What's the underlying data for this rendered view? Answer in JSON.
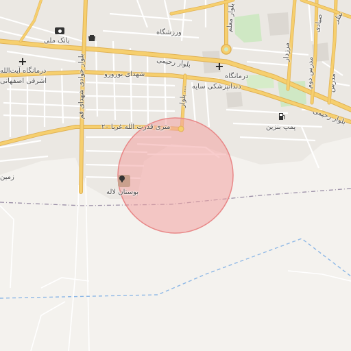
{
  "map": {
    "accent_road_color": "#f6cf6e",
    "circle_color": "#f3a3a3",
    "labels": {
      "bank_melli": "بانک ملی",
      "varzeshgah": "ورزشگاه",
      "darmangah_ayatollah_1": "درمانگاه آیت‌الله",
      "darmangah_ayatollah_2": "اشرفی اصفهانی",
      "shohadaye_borujerd": "شهدای بورورو",
      "blvd_rahimi_1": "بلوار رحیمی",
      "blvd_rahimi_2": "بلوار رحیمی",
      "blvd_moallem": "بلوار معلم",
      "darmangah": "درمانگاه",
      "dandanpezeshki": "دندانپزشکی سایه",
      "blvd_javadi": "بلوار جوادی شهدای قم",
      "qodratollah": "۲۰ متری قدرت الله غربا",
      "pomp_benzin": "پمپ بنزین",
      "bostan_laleh": "بوستان لاله",
      "zamin": "زمین",
      "marzdar": "مرزدار",
      "modares_doom": "مدرس دوم",
      "modares": "مدرس",
      "sayyadi": "صیادی",
      "nazar": "نظر",
      "side_road": "بلوار ..."
    },
    "icons": {
      "bank": "bank-icon",
      "stadium": "stadium-icon",
      "clinic1": "clinic-icon",
      "clinic2": "clinic-icon",
      "gas": "gas-station-icon",
      "park": "park-tree-icon",
      "roundabout": "roundabout-icon"
    }
  }
}
